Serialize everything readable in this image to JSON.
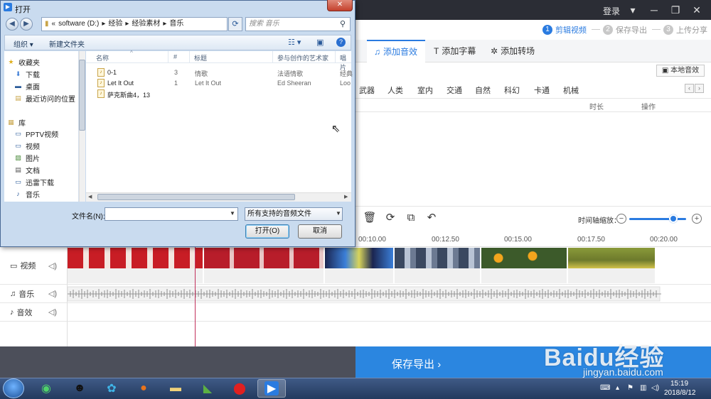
{
  "app": {
    "login": "登录",
    "steps": [
      {
        "num": "1",
        "label": "剪辑视频"
      },
      {
        "num": "2",
        "label": "保存导出"
      },
      {
        "num": "3",
        "label": "上传分享"
      }
    ],
    "tabs": [
      "添加音效",
      "添加字幕",
      "添加转场"
    ],
    "local_sound": "本地音效",
    "categories": [
      "武器",
      "人类",
      "室内",
      "交通",
      "自然",
      "科幻",
      "卡通",
      "机械"
    ],
    "list_headers": {
      "duration": "时长",
      "action": "操作"
    },
    "zoom_label": "时间轴缩放：",
    "ruler_ticks": [
      "00:10.00",
      "00:12.50",
      "00:15.00",
      "00:17.50",
      "00:20.00"
    ],
    "tracks": {
      "video": "视频",
      "music": "音乐",
      "effect": "音效"
    },
    "export_label": "保存导出",
    "zoom_level": 0.78
  },
  "dialog": {
    "title": "打开",
    "address": [
      "software (D:)",
      "经验",
      "经验素材",
      "音乐"
    ],
    "search_placeholder": "搜索 音乐",
    "organize": "组织",
    "new_folder": "新建文件夹",
    "nav": {
      "favorites": "收藏夹",
      "fav_items": [
        "下载",
        "桌面",
        "最近访问的位置"
      ],
      "library": "库",
      "lib_items": [
        "PPTV视频",
        "视频",
        "图片",
        "文档",
        "迅雷下载",
        "音乐"
      ]
    },
    "columns": [
      "名称",
      "#",
      "标题",
      "参与创作的艺术家",
      "唱片"
    ],
    "files": [
      {
        "name": "0-1",
        "num": "3",
        "title": "情歌",
        "artist": "法语情歌",
        "album": "经典"
      },
      {
        "name": "Let It Out",
        "num": "1",
        "title": "Let It Out",
        "artist": "Ed Sheeran",
        "album": "Loo"
      },
      {
        "name": "萨克斯曲4，13",
        "num": "",
        "title": "",
        "artist": "",
        "album": ""
      }
    ],
    "filename_label": "文件名(N):",
    "filename_value": "",
    "filetype": "所有支持的音频文件",
    "open_button": "打开(O)",
    "cancel_button": "取消"
  },
  "watermark": {
    "logo": "Baidu经验",
    "url": "jingyan.baidu.com"
  },
  "taskbar": {
    "time": "15:19",
    "date": "2018/8/12"
  },
  "colors": {
    "accent": "#2a7be0",
    "export_bar": "#2b86e0",
    "playhead": "#c1305c",
    "titlebar": "#2b2d35"
  }
}
